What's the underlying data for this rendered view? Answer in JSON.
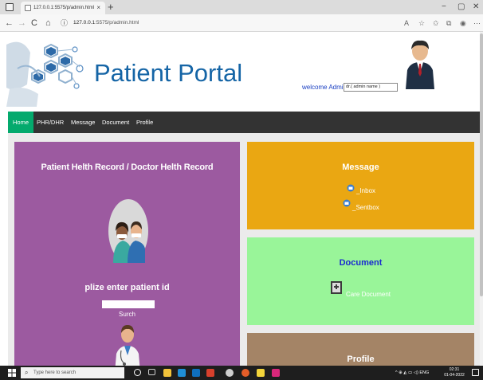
{
  "browser": {
    "tab_title": "127.0.0.1:5575/p/admin.html",
    "url_host": "127.0.0.1",
    "url_path": ":5575/p/admin.html",
    "new_tab_symbol": "+",
    "tab_close_symbol": "×",
    "minimize_symbol": "−",
    "maximize_symbol": "▢",
    "close_symbol": "✕",
    "back_symbol": "←",
    "forward_symbol": "→",
    "reload_symbol": "C",
    "home_symbol": "⌂",
    "info_symbol": "ⓘ",
    "toolbar_symbols": [
      "A",
      "☆",
      "✩",
      "⧉",
      "◉",
      "⋯"
    ]
  },
  "header": {
    "site_title": "Patient Portal",
    "welcome_text": "welcome Admin :",
    "user_field_value": "dr.( admin  name )"
  },
  "navbar": {
    "items": [
      {
        "label": "Home",
        "active": true
      },
      {
        "label": "PHR/DHR",
        "active": false
      },
      {
        "label": "Message",
        "active": false
      },
      {
        "label": "Document",
        "active": false
      },
      {
        "label": "Profile",
        "active": false
      }
    ]
  },
  "phr_card": {
    "title": "Patient Helth Record / Doctor Helth Record",
    "prompt": "plize enter patient id",
    "input_value": "",
    "search_label": "Surch"
  },
  "message_card": {
    "title": "Message",
    "inbox_label": "_Inbox",
    "sentbox_label": "_Sentbox"
  },
  "document_card": {
    "title": "Document",
    "link_label": "Care Document"
  },
  "profile_card": {
    "title": "Profile"
  },
  "taskbar": {
    "search_placeholder": "Type here to search",
    "tray_text": "^ ⊕ ◭ ▭ ◁) ENG",
    "time": "02:31",
    "date": "01-04-2022"
  },
  "colors": {
    "nav_active": "#04aa6d",
    "navbar_bg": "#333333",
    "phr_card": "#9c5aa0",
    "message_card": "#eaa712",
    "document_card": "#99f599",
    "profile_card": "#a48466",
    "title_blue": "#1565a6"
  }
}
